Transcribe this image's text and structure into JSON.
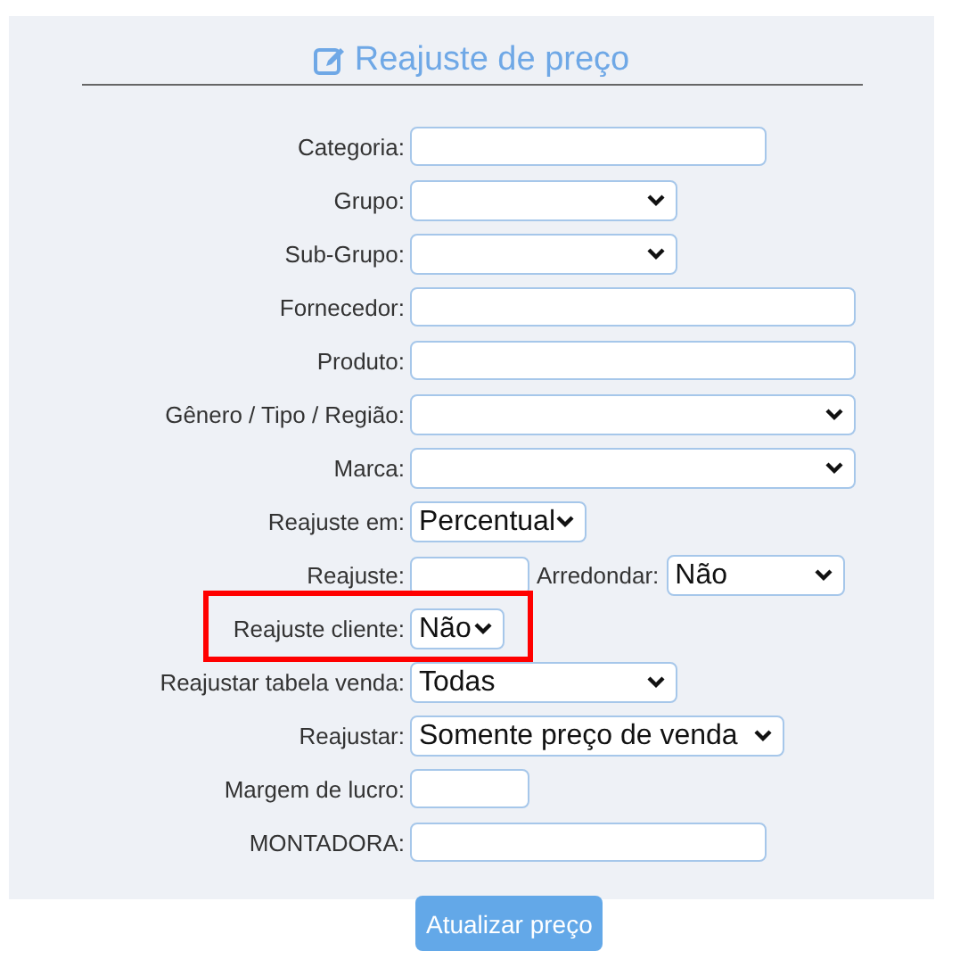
{
  "title": "Reajuste de preço",
  "rows": [
    {
      "label": "Categoria:",
      "controls": [
        {
          "kind": "text"
        }
      ]
    },
    {
      "label": "Grupo:",
      "controls": [
        {
          "kind": "select"
        }
      ]
    },
    {
      "label": "Sub-Grupo:",
      "controls": [
        {
          "kind": "select"
        }
      ]
    },
    {
      "label": "Fornecedor:",
      "controls": [
        {
          "kind": "text"
        }
      ]
    },
    {
      "label": "Produto:",
      "controls": [
        {
          "kind": "text"
        }
      ]
    },
    {
      "label": "Gênero / Tipo / Região:",
      "controls": [
        {
          "kind": "select"
        }
      ]
    },
    {
      "label": "Marca:",
      "controls": [
        {
          "kind": "select"
        }
      ]
    },
    {
      "label": "Reajuste em:",
      "controls": [
        {
          "kind": "select",
          "value": "Percentual"
        }
      ]
    },
    {
      "label": "Reajuste:",
      "controls": [
        {
          "kind": "text"
        },
        {
          "kind": "label",
          "text": "Arredondar:"
        },
        {
          "kind": "select",
          "value": "Não"
        }
      ]
    },
    {
      "label": "Reajuste cliente:",
      "highlighted": true,
      "controls": [
        {
          "kind": "select",
          "value": "Não"
        }
      ]
    },
    {
      "label": "Reajustar tabela venda:",
      "controls": [
        {
          "kind": "select",
          "value": "Todas"
        }
      ]
    },
    {
      "label": "Reajustar:",
      "controls": [
        {
          "kind": "select",
          "value": "Somente preço de venda"
        }
      ]
    },
    {
      "label": "Margem de lucro:",
      "controls": [
        {
          "kind": "text"
        }
      ]
    },
    {
      "label": "MONTADORA:",
      "controls": [
        {
          "kind": "text"
        }
      ]
    }
  ],
  "button": "Atualizar preço"
}
